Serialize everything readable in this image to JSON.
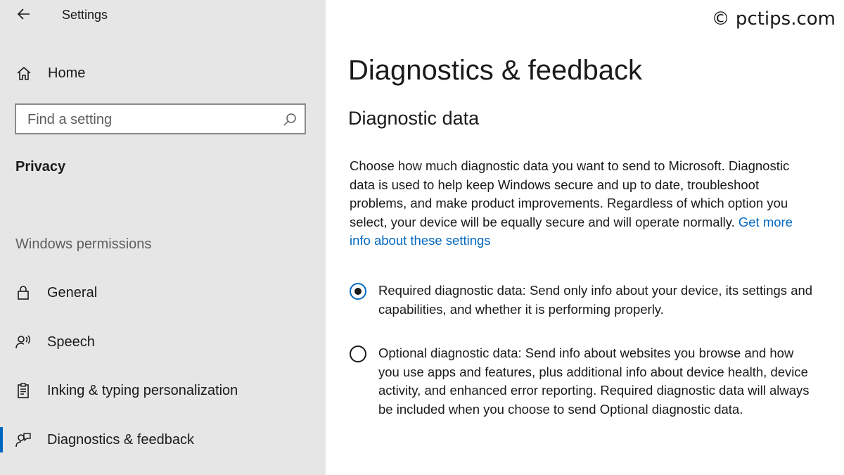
{
  "window": {
    "title": "Settings"
  },
  "watermark": "© pctips.com",
  "sidebar": {
    "home_label": "Home",
    "search_placeholder": "Find a setting",
    "section_label": "Privacy",
    "group_label": "Windows permissions",
    "items": [
      {
        "label": "General",
        "icon": "lock-icon"
      },
      {
        "label": "Speech",
        "icon": "speech-icon"
      },
      {
        "label": "Inking & typing personalization",
        "icon": "clipboard-icon"
      },
      {
        "label": "Diagnostics & feedback",
        "icon": "feedback-icon",
        "selected": true
      }
    ]
  },
  "main": {
    "page_title": "Diagnostics & feedback",
    "section_title": "Diagnostic data",
    "description": "Choose how much diagnostic data you want to send to Microsoft. Diagnostic data is used to help keep Windows secure and up to date, troubleshoot problems, and make product improvements. Regardless of which option you select, your device will be equally secure and will operate normally.",
    "link_text": "Get more info about these settings",
    "options": [
      {
        "label": "Required diagnostic data: Send only info about your device, its settings and capabilities, and whether it is performing properly.",
        "checked": true
      },
      {
        "label": "Optional diagnostic data: Send info about websites you browse and how you use apps and features, plus additional info about device health, device activity, and enhanced error reporting. Required diagnostic data will always be included when you choose to send Optional diagnostic data.",
        "checked": false
      }
    ]
  },
  "colors": {
    "accent": "#0067c0",
    "sidebar_bg": "#e6e6e6",
    "link": "#0067c0"
  }
}
